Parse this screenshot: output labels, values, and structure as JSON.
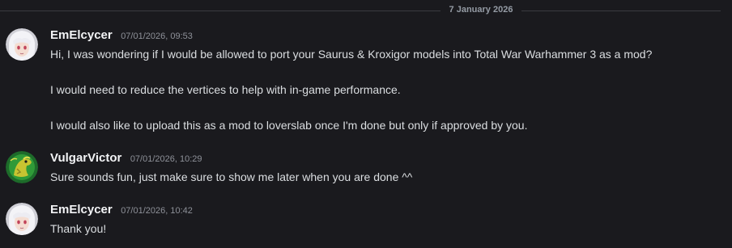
{
  "divider": {
    "date": "7 January 2026"
  },
  "messages": [
    {
      "username": "EmElcycer",
      "timestamp": "07/01/2026, 09:53",
      "avatar": "anime-girl-white-hair",
      "lines": [
        "Hi, I was wondering if I would be allowed to port your Saurus & Kroxigor models into Total War Warhammer 3 as a mod?",
        "I would need to reduce the vertices to help with in-game performance.",
        "I would also like to upload this as a mod to loverslab once I'm done but only if approved by you."
      ]
    },
    {
      "username": "VulgarVictor",
      "timestamp": "07/01/2026, 10:29",
      "avatar": "green-lizard",
      "lines": [
        "Sure sounds fun, just make sure to show me later when you are done ^^"
      ]
    },
    {
      "username": "EmElcycer",
      "timestamp": "07/01/2026, 10:42",
      "avatar": "anime-girl-white-hair",
      "lines": [
        "Thank you!"
      ]
    }
  ],
  "colors": {
    "background": "#1a1a1e",
    "username": "#f2f3f5",
    "text": "#dbdee1",
    "timestamp": "#8e9199",
    "divider_line": "#3a3b41"
  }
}
